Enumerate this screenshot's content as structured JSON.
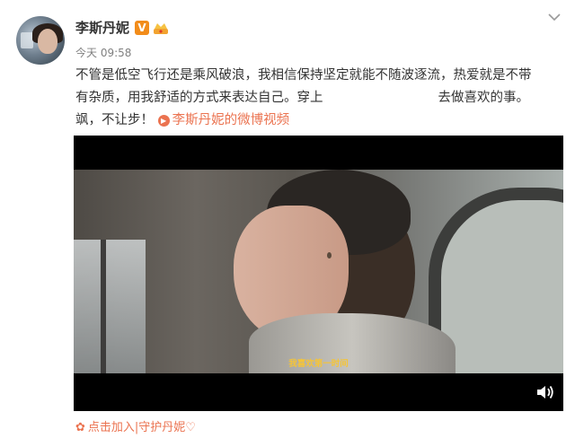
{
  "post": {
    "username": "李斯丹妮",
    "verified_badge": "V",
    "time": "今天 09:58",
    "content_lines": [
      "不管是低空飞行还是乘风破浪，我相信保持坚定就能不随波逐流，热爱就是不带",
      "有杂质，用我舒适的方式来表达自己。穿上",
      "去做喜欢的事。",
      "飒，不让步！"
    ],
    "video_link_label": "李斯丹妮的微博视频",
    "video": {
      "subtitle": "我喜欢第一时间"
    },
    "footer_label": "点击加入|守护丹妮♡"
  },
  "colors": {
    "link": "#eb7350",
    "verified_badge": "#f28c1a",
    "subtitle": "#f4c43a"
  },
  "icons": [
    "more-chevron-icon",
    "verified-icon",
    "crown-icon",
    "video-play-icon",
    "volume-icon",
    "flower-icon"
  ]
}
